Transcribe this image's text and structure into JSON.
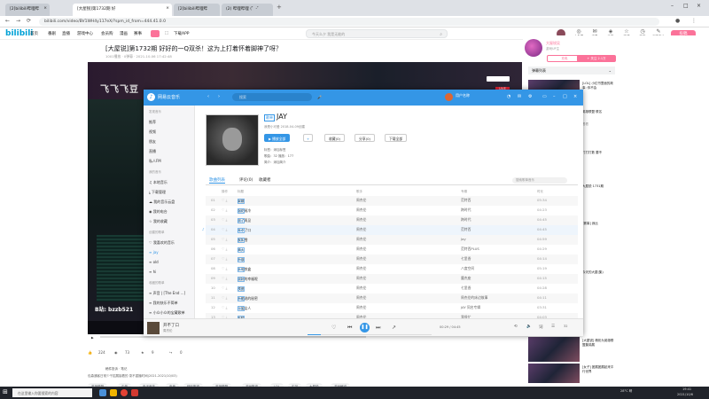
{
  "browser": {
    "tabs": [
      {
        "label": "[2]bilibili哔哩哔"
      },
      {
        "label": "[大屋锐]第1732期 好"
      },
      {
        "label": "[2]bilibili哔哩哔"
      },
      {
        "label": "(2) 哔哩哔哩 (゜-゜"
      }
    ],
    "url": "bilibili.com/video/BV1WH4y117eX/?spm_id_from=444.41.0.0"
  },
  "bili": {
    "logo": "bilibili",
    "nav": [
      "首页",
      "番剧",
      "直播",
      "游戏中心",
      "会员购",
      "漫画",
      "赛事"
    ],
    "download_app": "下载APP",
    "search_placeholder": "今天么夕 我是无能的",
    "header_icons": [
      {
        "icon": "avatar",
        "label": "大会员"
      },
      {
        "icon": "message-icon",
        "label": "消息"
      },
      {
        "icon": "dynamic-icon",
        "label": "动态"
      },
      {
        "icon": "favorite-icon",
        "label": "收藏"
      },
      {
        "icon": "history-icon",
        "label": "历史"
      },
      {
        "icon": "creator-icon",
        "label": "创作中心"
      }
    ],
    "upload": "投稿",
    "video_title": "[大屋锐]第1732期 好好的一Q双杀！这为上打着怀着脚神了呀？",
    "video_meta": "1001播放 · 0弹幕 · 2021-10-06 17:42:48",
    "video_overlay_text": "飞飞飞豆",
    "stream_tag": "B站: bzzb521",
    "actions": {
      "like": "224",
      "coin": "73",
      "fav": "9",
      "share": "0"
    },
    "tag_line": "稿件投诉 · 笔记",
    "description": "包森通客日常少干招展接着的 录不重播时间(2021-2021/10/03)",
    "tags": [
      "英雄联盟",
      "中单",
      "电子竞技",
      "电竞",
      "精彩集锦",
      "英雄联盟",
      "游戏集锦",
      "LOL",
      "实况",
      "大屋锐",
      "游戏解说"
    ],
    "danmu_list": "弹幕列表",
    "up": {
      "name": "大屋锐吴",
      "sub": "游戏UP主",
      "charge": "充电",
      "follow": "+ 关注 2.1万"
    },
    "rec": [
      {
        "title": "[LOL] 小红书里面的故事: 你不会"
      },
      {
        "title": "英雄联盟 联名",
        "sub": "看看"
      },
      {
        "title": "打打打数 要不"
      },
      {
        "title": "大屋锐 1731期"
      },
      {
        "title": "[赛事] 我比"
      },
      {
        "title": "今天的大屋(集)"
      },
      {
        "title": "[大屋锐] 精彩为英雄联盟集锦展"
      },
      {
        "title": "[女子] 团展团展起来平行世界"
      }
    ]
  },
  "netease": {
    "app_title": "网易云音乐",
    "search_placeholder": "搜索",
    "user": "用户名称",
    "sidebar": [
      {
        "label": "发现音乐",
        "header": true
      },
      {
        "label": "推荐"
      },
      {
        "label": "视频"
      },
      {
        "label": "朋友"
      },
      {
        "label": "直播"
      },
      {
        "label": "私人FM"
      },
      {
        "label": "我的音乐",
        "header": true
      },
      {
        "label": "本地音乐"
      },
      {
        "label": "下载管理"
      },
      {
        "label": "我的音乐云盘"
      },
      {
        "label": "我的电台"
      },
      {
        "label": "我的收藏"
      },
      {
        "label": "创建的歌单",
        "header": true
      },
      {
        "label": "我喜欢的音乐"
      },
      {
        "label": "jay"
      },
      {
        "label": "old"
      },
      {
        "label": "hi"
      },
      {
        "label": "收藏的歌单",
        "header": true
      },
      {
        "label": "声音 | [The End ...]"
      },
      {
        "label": "我的快乐不简单"
      },
      {
        "label": "小众小众的宝藏歌单"
      }
    ],
    "playlist": {
      "tag": "歌单",
      "title": "JAY",
      "creator": "我是小可爱 2018-04-09创建",
      "play_all": "播放全部",
      "collect": "收藏(0)",
      "share": "分享(0)",
      "download": "下载全部",
      "tags_label": "标签：添加标签",
      "stats_label": "歌曲：32    播放：177",
      "intro_label": "简介：添加简介"
    },
    "tabs": [
      "歌曲列表",
      "评论(0)",
      "收藏者"
    ],
    "list_search_placeholder": "搜索歌单音乐",
    "columns": {
      "ops": "操作",
      "title": "标题",
      "artist": "歌手",
      "album": "专辑",
      "duration": "时长"
    },
    "songs": [
      {
        "num": "01",
        "title": "安静",
        "tag": "SQ",
        "artist": "周杰伦",
        "album": "范特西",
        "duration": "05:34"
      },
      {
        "num": "02",
        "title": "烟花易冷",
        "tag": "SQ",
        "artist": "周杰伦",
        "album": "跨时代",
        "duration": "04:23"
      },
      {
        "num": "03",
        "title": "说了再见",
        "tag": "SQ",
        "artist": "周杰伦",
        "album": "跨时代",
        "duration": "04:45"
      },
      {
        "num": "04",
        "title": "开不了口",
        "tag": "SQ",
        "artist": "周杰伦",
        "album": "范特西",
        "duration": "04:45"
      },
      {
        "num": "05",
        "title": "发如雪",
        "tag": "SQ",
        "artist": "周杰伦",
        "album": "Jay",
        "duration": "04:59"
      },
      {
        "num": "06",
        "title": "晴天",
        "tag": "SQ",
        "artist": "周杰伦",
        "album": "范特西PLUS",
        "duration": "04:29"
      },
      {
        "num": "07",
        "title": "不该",
        "tag": "SQ",
        "artist": "周杰伦",
        "album": "七里香",
        "duration": "04:14"
      },
      {
        "num": "08",
        "title": "半岛铁盒",
        "tag": "SQ",
        "artist": "周杰伦",
        "album": "八度空间",
        "duration": "05:19"
      },
      {
        "num": "09",
        "title": "说好的幸福呢",
        "tag": "SQ",
        "artist": "周杰伦",
        "album": "魔杰座",
        "duration": "04:15"
      },
      {
        "num": "10",
        "title": "夜曲",
        "tag": "SQ",
        "artist": "周杰伦",
        "album": "七里香",
        "duration": "04:28"
      },
      {
        "num": "11",
        "title": "不能说的秘密",
        "tag": "SQ",
        "artist": "周杰伦",
        "album": "周杰伦的床边故事",
        "duration": "04:11"
      },
      {
        "num": "12",
        "title": "可爱女人",
        "tag": "SQ",
        "artist": "周杰伦",
        "album": "JAY 同名专辑",
        "duration": "03:31"
      },
      {
        "num": "13",
        "title": "彩虹",
        "tag": "SQ",
        "artist": "周杰伦",
        "album": "我很忙",
        "duration": "04:03"
      }
    ],
    "now_playing": {
      "title": "开不了口",
      "artist": "周杰伦",
      "time": "00:29 / 04:45",
      "progress": 0.11,
      "count": "32"
    }
  },
  "taskbar": {
    "search": "在这里输入你要搜索的内容",
    "weather": "28°C 晴",
    "clock": "19:41",
    "date": "2021/10/6"
  },
  "colors": {
    "netease_blue": "#3496e6",
    "bili_pink": "#fb7299",
    "bili_blue": "#00a1d6"
  }
}
